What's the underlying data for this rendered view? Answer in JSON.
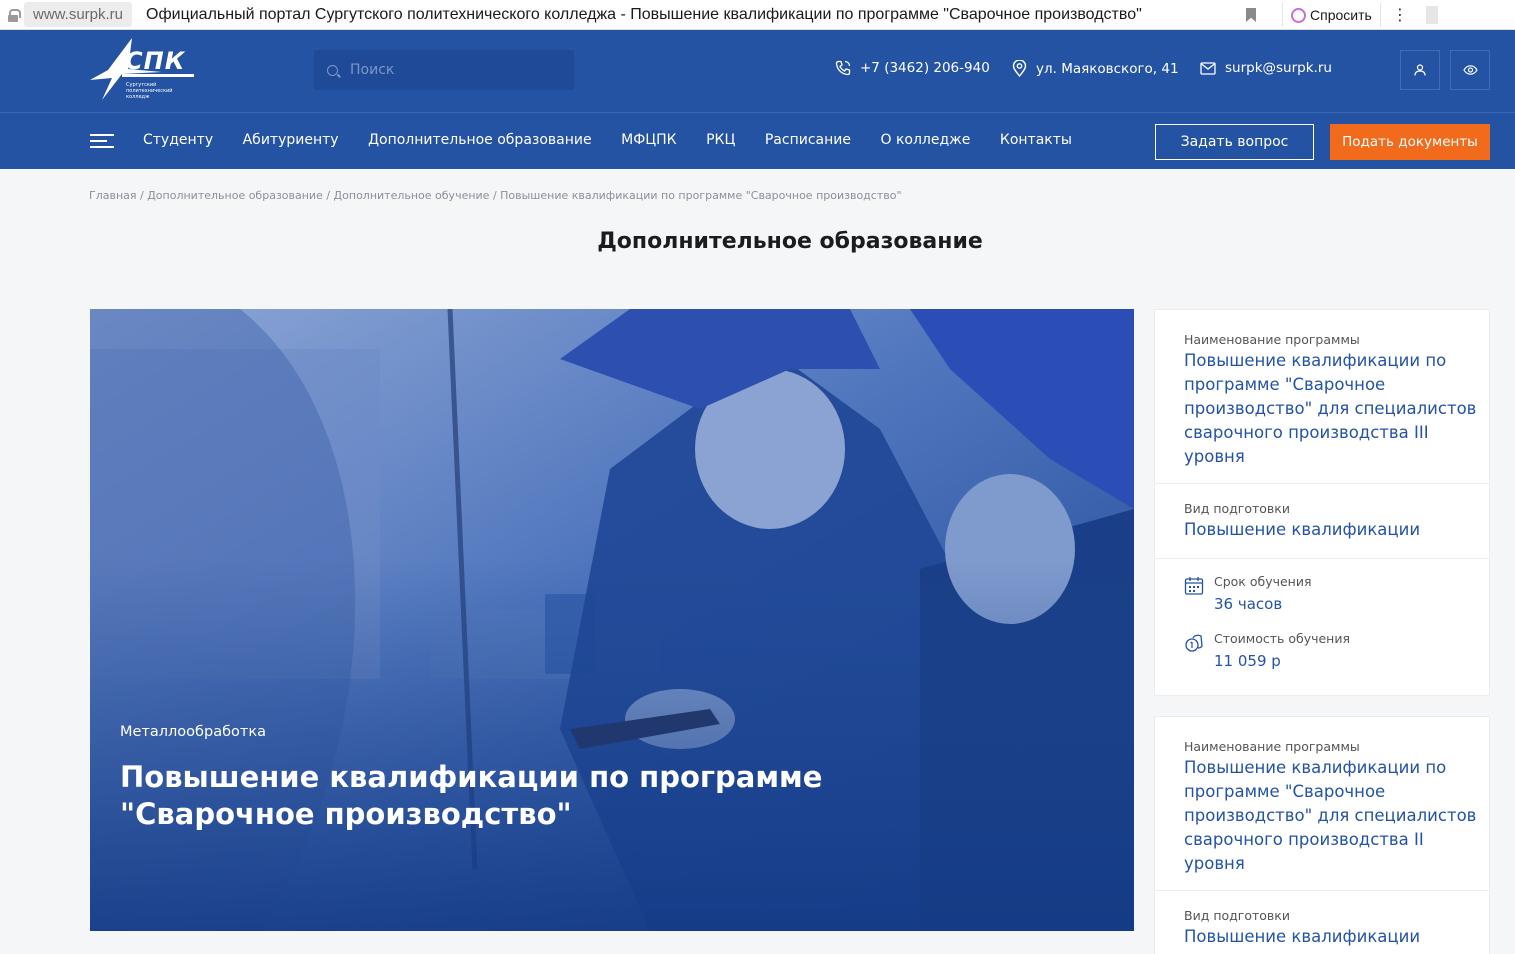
{
  "browser": {
    "url": "www.surpk.ru",
    "title": "Официальный портал Сургутского политехнического колледжа - Повышение квалификации по программе \"Сварочное производство\"",
    "ask_label": "Спросить",
    "menu_glyph": "⋮"
  },
  "header": {
    "logo_text": "СПК",
    "logo_subtitle": [
      "Сургутский",
      "политехнический",
      "колледж"
    ],
    "search_placeholder": "Поиск",
    "phone": "+7 (3462) 206-940",
    "address": "ул. Маяковского, 41",
    "email": "surpk@surpk.ru"
  },
  "nav": {
    "items": [
      "Студенту",
      "Абитуриенту",
      "Дополнительное образование",
      "МФЦПК",
      "РКЦ",
      "Расписание",
      "О колледже",
      "Контакты"
    ],
    "ask_button": "Задать вопрос",
    "submit_button": "Подать документы"
  },
  "breadcrumb": "Главная / Дополнительное образование / Дополнительное обучение / Повышение квалификации по программе \"Сварочное производство\"",
  "page_title": "Дополнительное образование",
  "hero": {
    "category": "Металлообработка",
    "title": "Повышение квалификации по программе \"Сварочное производство\""
  },
  "cards": [
    {
      "program_label": "Наименование программы",
      "program_name": "Повышение квалификации по программе \"Сварочное производство\" для специалистов сварочного производства III уровня",
      "type_label": "Вид подготовки",
      "type_value": "Повышение квалификации",
      "duration_label": "Срок обучения",
      "duration_value": "36 часов",
      "cost_label": "Стоимость обучения",
      "cost_value": "11 059 р"
    },
    {
      "program_label": "Наименование программы",
      "program_name": "Повышение квалификации по программе \"Сварочное производство\" для специалистов сварочного производства II уровня",
      "type_label": "Вид подготовки",
      "type_value": "Повышение квалификации"
    }
  ],
  "colors": {
    "brand_blue": "#2453a3",
    "accent_orange": "#f26b1d",
    "background": "#f5f6f8"
  }
}
